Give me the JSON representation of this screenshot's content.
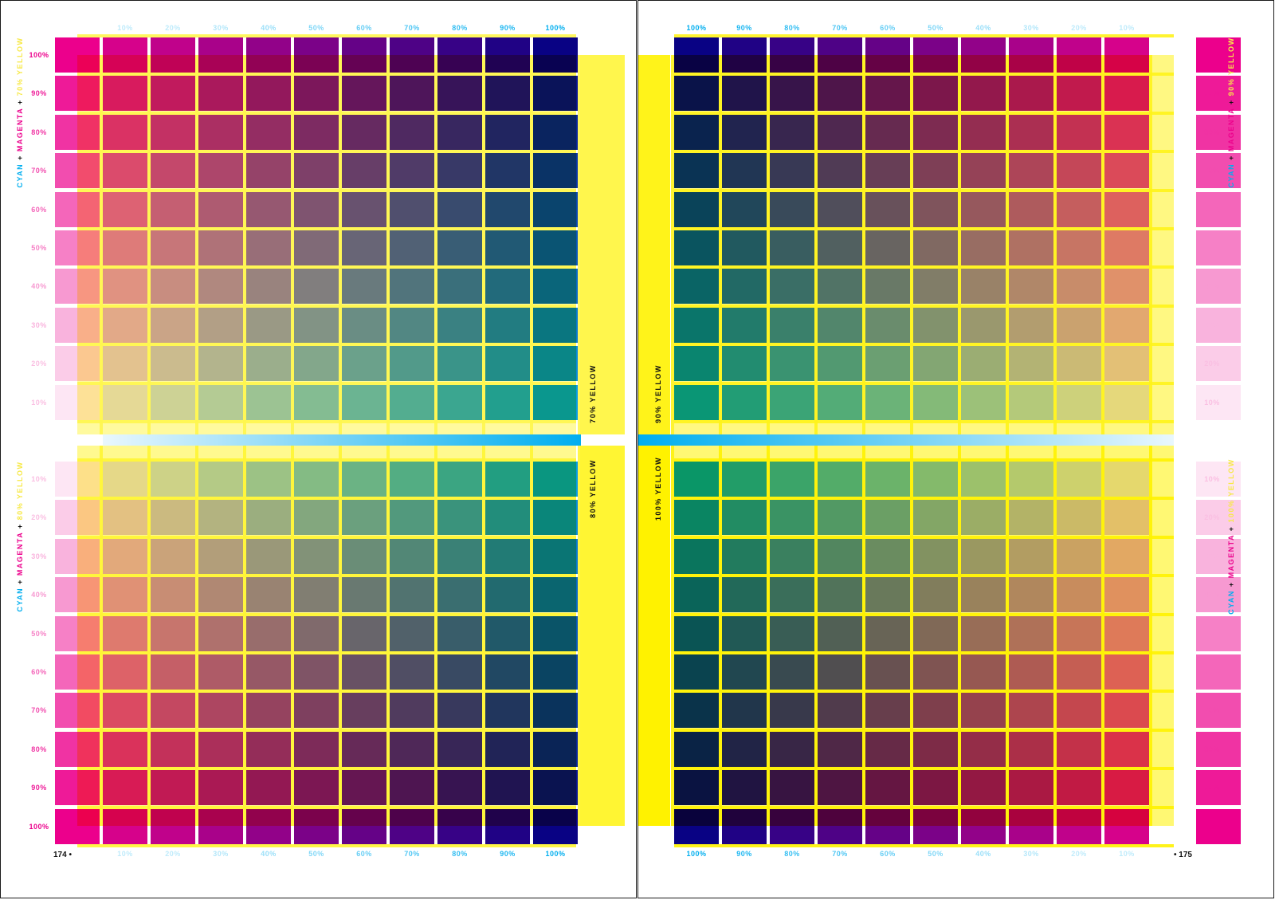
{
  "pages": [
    {
      "number_text": "174 •",
      "side": "left"
    },
    {
      "number_text": "• 175",
      "side": "right"
    }
  ],
  "colors": {
    "cyan": "#00aeef",
    "magenta": "#ec008c",
    "yellow": "#fff200",
    "yellow_label": "#f7e948",
    "overlay_yellow": "#fff200",
    "ink": "#111111",
    "page_border": "#1a1a1a"
  },
  "scale_percent_values": [
    10,
    20,
    30,
    40,
    50,
    60,
    70,
    80,
    90,
    100
  ],
  "scale_labels": [
    "10%",
    "20%",
    "30%",
    "40%",
    "50%",
    "60%",
    "70%",
    "80%",
    "90%",
    "100%"
  ],
  "charts": [
    {
      "id": "top-left",
      "page": 0,
      "yellow_percent": 70,
      "yellow_label": "70% YELLOW",
      "side_title": [
        {
          "text": "CYAN",
          "color": "cyan"
        },
        {
          "text": " + ",
          "color": "ink"
        },
        {
          "text": "MAGENTA",
          "color": "magenta"
        },
        {
          "text": " + ",
          "color": "ink"
        },
        {
          "text": "70% YELLOW",
          "color": "yellow_label"
        }
      ],
      "cyan_axis_order": [
        10,
        20,
        30,
        40,
        50,
        60,
        70,
        80,
        90,
        100
      ],
      "magenta_axis_order": [
        100,
        90,
        80,
        70,
        60,
        50,
        40,
        30,
        20,
        10
      ]
    },
    {
      "id": "bottom-left",
      "page": 0,
      "yellow_percent": 80,
      "yellow_label": "80% YELLOW",
      "side_title": [
        {
          "text": "CYAN",
          "color": "cyan"
        },
        {
          "text": " + ",
          "color": "ink"
        },
        {
          "text": "MAGENTA",
          "color": "magenta"
        },
        {
          "text": " + ",
          "color": "ink"
        },
        {
          "text": "80% YELLOW",
          "color": "yellow_label"
        }
      ],
      "cyan_axis_order": [
        10,
        20,
        30,
        40,
        50,
        60,
        70,
        80,
        90,
        100
      ],
      "magenta_axis_order": [
        10,
        20,
        30,
        40,
        50,
        60,
        70,
        80,
        90,
        100
      ]
    },
    {
      "id": "top-right",
      "page": 1,
      "yellow_percent": 90,
      "yellow_label": "90% YELLOW",
      "side_title": [
        {
          "text": "CYAN",
          "color": "cyan"
        },
        {
          "text": " + ",
          "color": "ink"
        },
        {
          "text": "MAGENTA",
          "color": "magenta"
        },
        {
          "text": " + ",
          "color": "ink"
        },
        {
          "text": "90% YELLOW",
          "color": "yellow_label"
        }
      ],
      "cyan_axis_order": [
        100,
        90,
        80,
        70,
        60,
        50,
        40,
        30,
        20,
        10
      ],
      "magenta_axis_order": [
        100,
        90,
        80,
        70,
        60,
        50,
        40,
        30,
        20,
        10
      ]
    },
    {
      "id": "bottom-right",
      "page": 1,
      "yellow_percent": 100,
      "yellow_label": "100% YELLOW",
      "side_title": [
        {
          "text": "CYAN",
          "color": "cyan"
        },
        {
          "text": " + ",
          "color": "ink"
        },
        {
          "text": "MAGENTA",
          "color": "magenta"
        },
        {
          "text": " + ",
          "color": "ink"
        },
        {
          "text": "100% YELLOW",
          "color": "yellow_label"
        }
      ],
      "cyan_axis_order": [
        100,
        90,
        80,
        70,
        60,
        50,
        40,
        30,
        20,
        10
      ],
      "magenta_axis_order": [
        10,
        20,
        30,
        40,
        50,
        60,
        70,
        80,
        90,
        100
      ]
    }
  ]
}
